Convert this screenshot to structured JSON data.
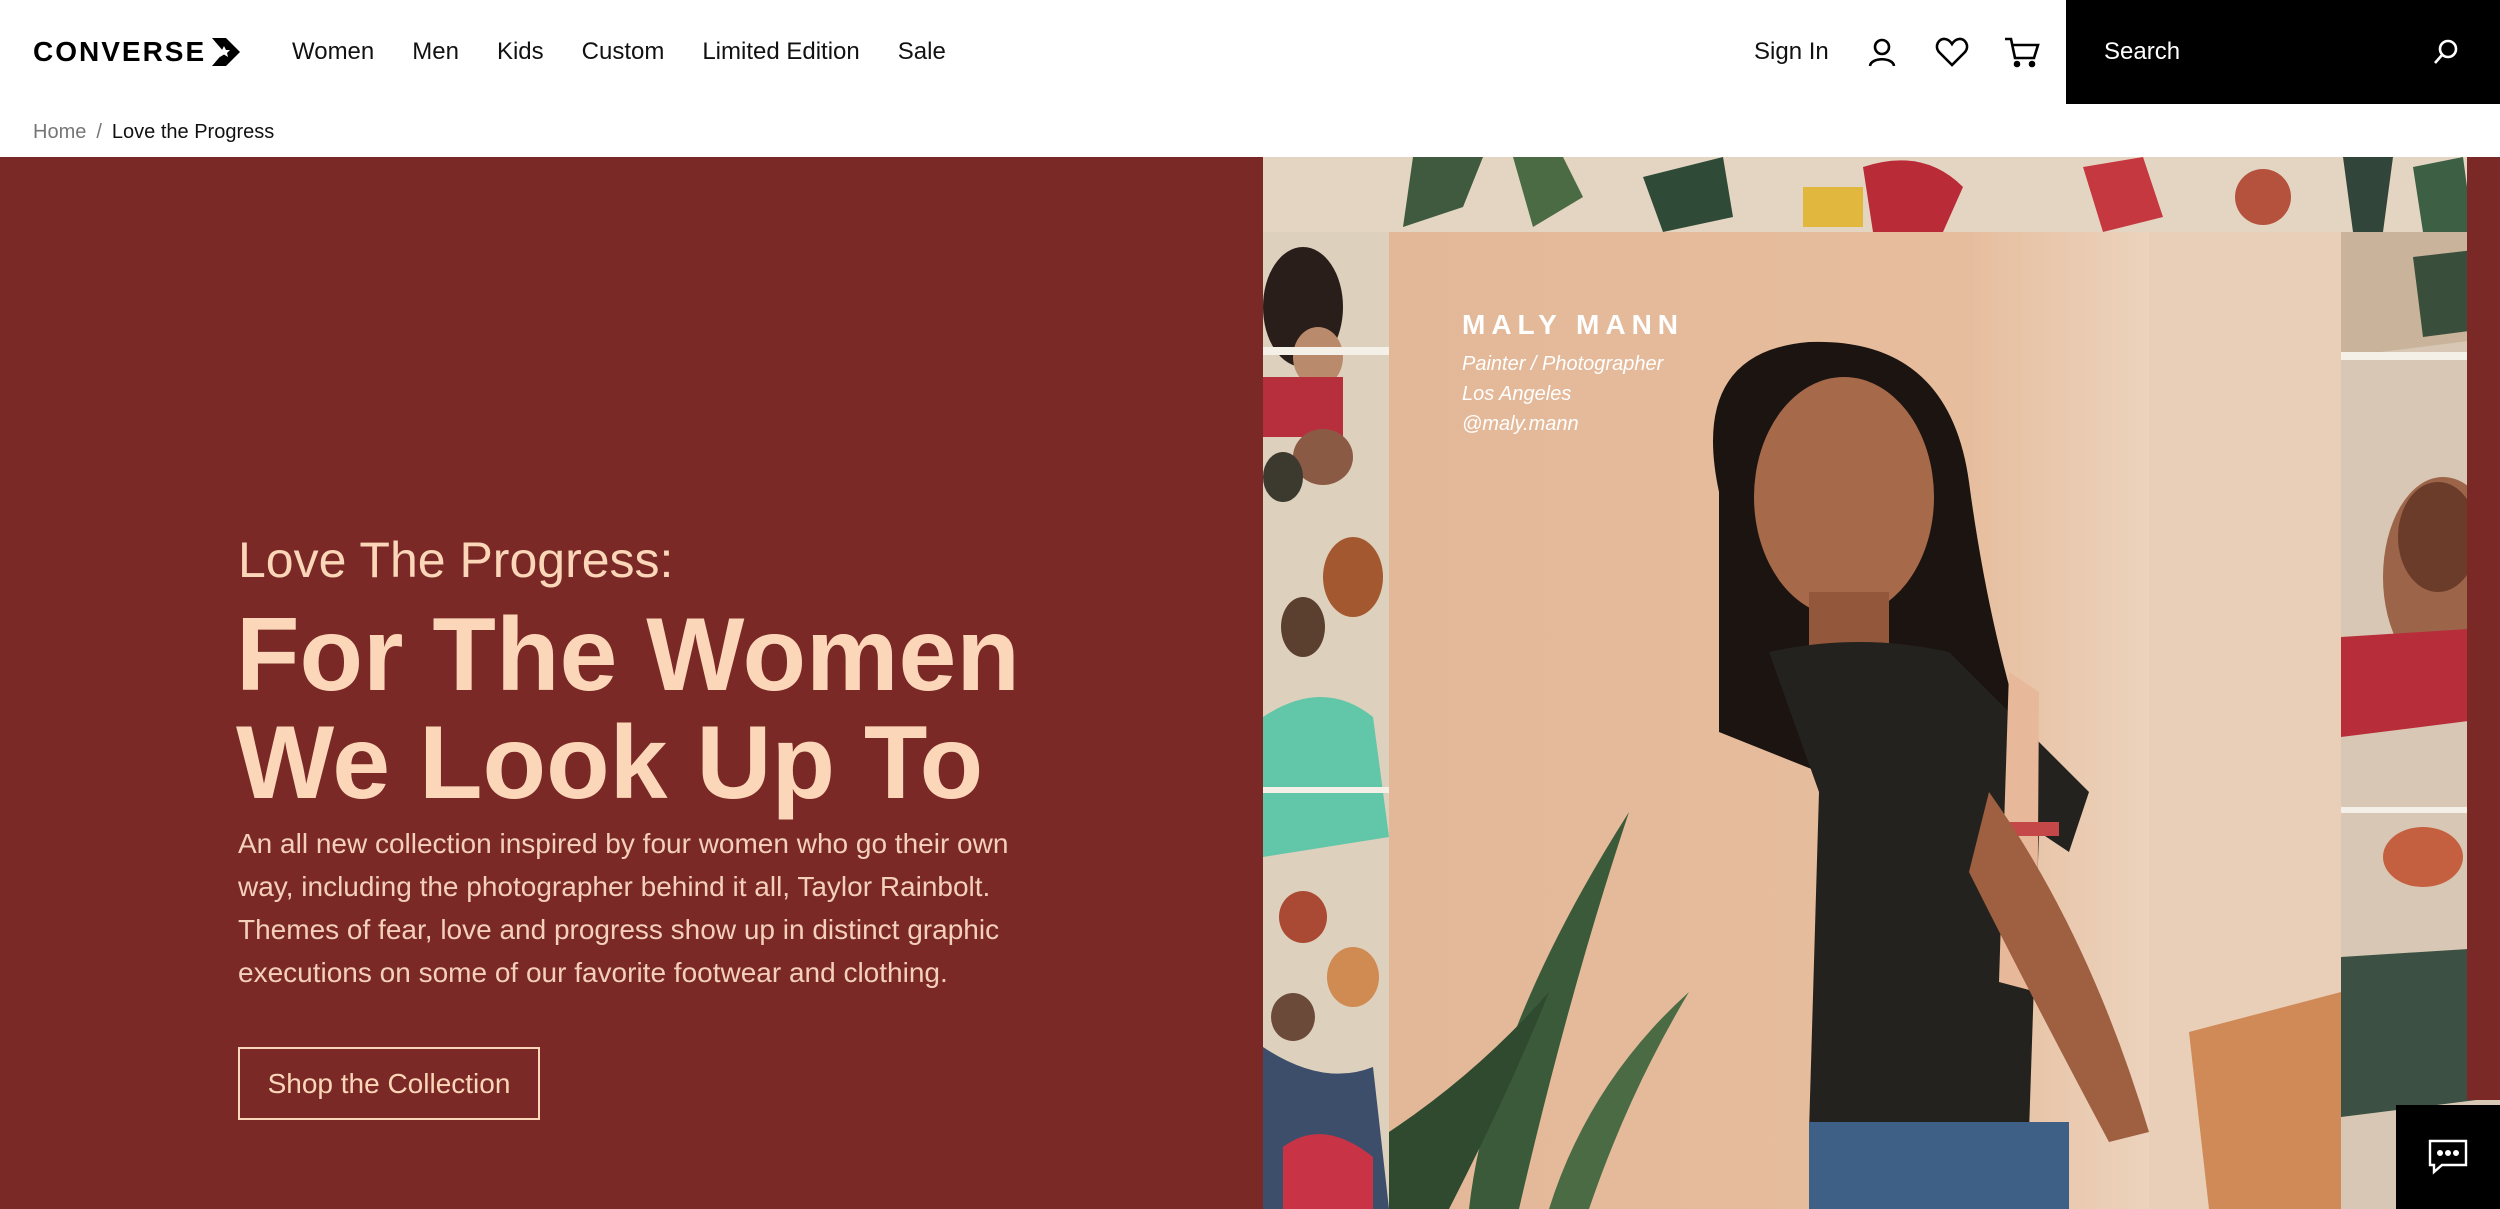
{
  "brand": {
    "logo_text": "CONVERSE",
    "logo_icon": "star-chevron-icon"
  },
  "nav": {
    "items": [
      "Women",
      "Men",
      "Kids",
      "Custom",
      "Limited Edition",
      "Sale"
    ]
  },
  "account": {
    "sign_in": "Sign In",
    "icons": [
      "user-icon",
      "heart-icon",
      "cart-icon"
    ]
  },
  "search": {
    "placeholder": "Search",
    "icon": "search-icon"
  },
  "breadcrumb": {
    "home": "Home",
    "separator": "/",
    "current": "Love the Progress"
  },
  "hero": {
    "kicker": "Love The Progress:",
    "title_line1": "For The Women",
    "title_line2": "We Look Up To",
    "body": "An all new collection inspired by four women who go their own way, including the photographer behind it all, Taylor Rainbolt. Themes of fear, love and progress show up in distinct graphic executions on some of our favorite footwear and clothing.",
    "cta": "Shop the Collection",
    "background_color": "#7a2927",
    "text_color": "#fbd6b8"
  },
  "feature": {
    "name": "MALY MANN",
    "role": "Painter / Photographer",
    "location": "Los Angeles",
    "handle": "@maly.mann"
  },
  "chat": {
    "icon": "chat-icon"
  }
}
